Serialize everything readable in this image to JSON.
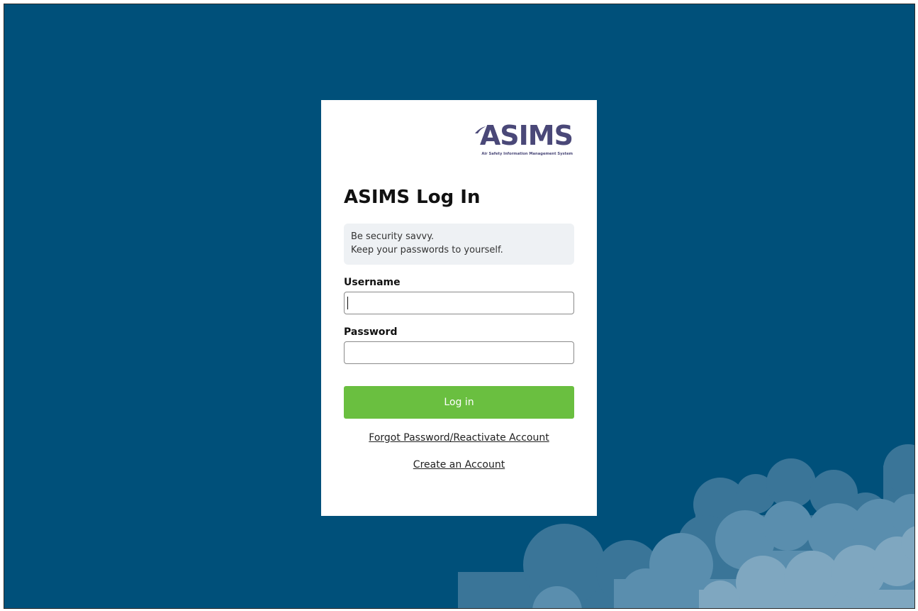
{
  "logo": {
    "word": "ASIMS",
    "tagline": "Air Safety Information Management System"
  },
  "login": {
    "title": "ASIMS Log In",
    "notice_line1": "Be security savvy.",
    "notice_line2": "Keep your passwords to yourself.",
    "username_label": "Username",
    "username_value": "",
    "password_label": "Password",
    "password_value": "",
    "submit_label": "Log in",
    "forgot_link": "Forgot Password/Reactivate Account",
    "create_link": "Create an Account"
  },
  "colors": {
    "background": "#00507a",
    "card": "#ffffff",
    "button": "#6abf40",
    "logo": "#4a4878",
    "notice_bg": "#eef1f4",
    "cloud_dark": "#3a7598",
    "cloud_mid": "#5a8eae",
    "cloud_light": "#7fa7c0"
  }
}
